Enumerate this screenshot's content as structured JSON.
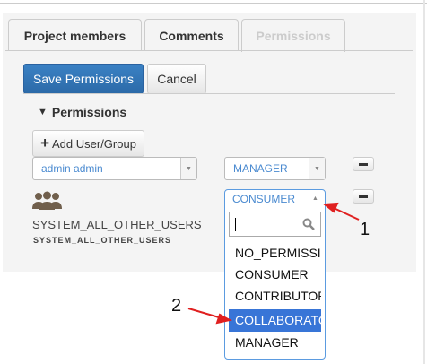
{
  "tabs": [
    {
      "label": "Project members"
    },
    {
      "label": "Comments"
    },
    {
      "label": "Permissions",
      "active": true
    }
  ],
  "toolbar": {
    "save_label": "Save Permissions",
    "cancel_label": "Cancel"
  },
  "section": {
    "title": "Permissions",
    "toggle": "▼"
  },
  "add_button": {
    "label": "Add User/Group",
    "icon": "plus-icon"
  },
  "rows": [
    {
      "user": "admin admin",
      "role": "MANAGER"
    },
    {
      "group_name": "SYSTEM_ALL_OTHER_USERS",
      "group_id": "SYSTEM_ALL_OTHER_USERS",
      "role": "CONSUMER",
      "icon": "users-icon"
    }
  ],
  "dropdown": {
    "search_value": "",
    "options": [
      "NO_PERMISSION",
      "CONSUMER",
      "CONTRIBUTOR",
      "COLLABORATOR",
      "MANAGER"
    ],
    "highlighted": "COLLABORATOR"
  },
  "annotations": {
    "a1": "1",
    "a2": "2"
  },
  "colors": {
    "primary": "#2c6aa8",
    "highlight": "#3875d7",
    "arrow": "#e02020"
  }
}
